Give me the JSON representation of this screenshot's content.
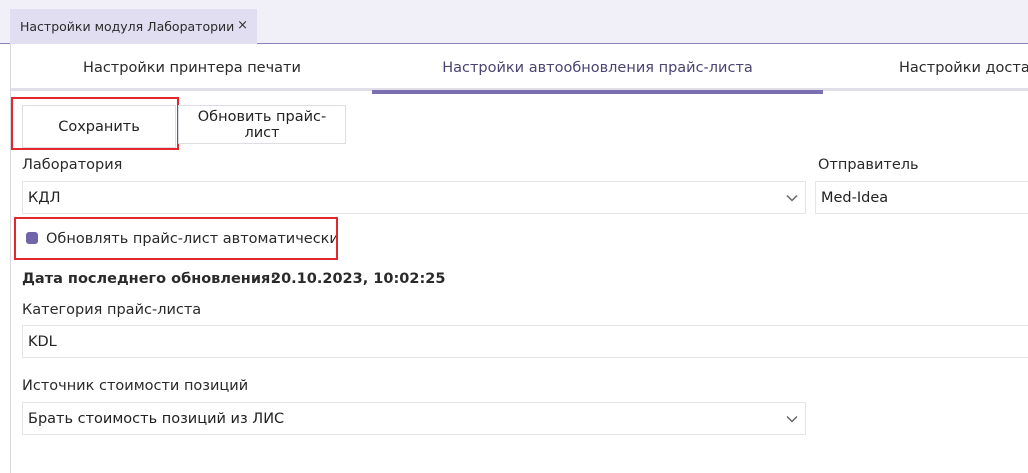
{
  "doc_tab": {
    "title": "Настройки модуля Лаборатории",
    "close": "×"
  },
  "subtabs": [
    {
      "label": "Настройки принтера печати"
    },
    {
      "label": "Настройки автообновления прайс-листа"
    },
    {
      "label": "Настройки доставки"
    }
  ],
  "toolbar": {
    "save_label": "Сохранить",
    "refresh_label": "Обновить прайс-лист"
  },
  "form": {
    "laboratory_label": "Лаборатория",
    "laboratory_value": "КДЛ",
    "sender_label": "Отправитель",
    "sender_value": "Med-Idea",
    "auto_update_label": "Обновлять прайс-лист автоматически",
    "auto_update_checked": true,
    "last_update_label": "Дата последнего обновления:",
    "last_update_value": "20.10.2023, 10:02:25",
    "category_label": "Категория прайс-листа",
    "category_value": "KDL",
    "cost_source_label": "Источник стоимости позиций",
    "cost_source_value": "Брать стоимость позиций из ЛИС"
  },
  "colors": {
    "accent": "#7b6fb0",
    "highlight": "#e0282e",
    "checkbox": "#7065a8"
  }
}
